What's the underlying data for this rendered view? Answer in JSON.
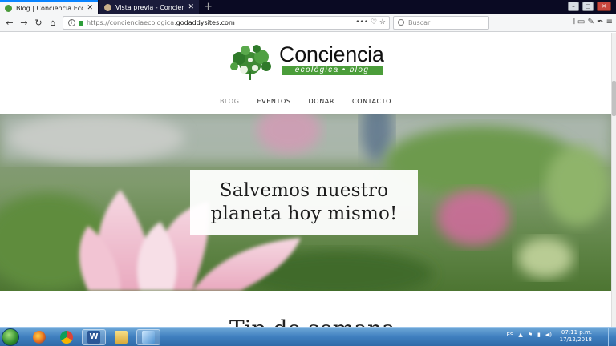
{
  "browser": {
    "tabs": [
      {
        "title": "Blog | Conciencia Ecológica",
        "close": "✕"
      },
      {
        "title": "Vista previa - Conciencia Ecoló",
        "close": "✕"
      }
    ],
    "new_tab": "+",
    "url_prefix": "https://concienciaecologica.",
    "url_domain": "godaddysites.com",
    "url_actions": "••• ♡ ☆",
    "search_placeholder": "Buscar",
    "tools": "𝄃 ▭ ✎ ✒ ≡"
  },
  "site": {
    "brand_name": "Conciencia",
    "brand_tagline": "ecológica • blog",
    "menu": [
      "BLOG",
      "EVENTOS",
      "DONAR",
      "CONTACTO"
    ],
    "hero_heading": "Salvemos nuestro planeta hoy mismo!",
    "partial_heading": "Tip de semana"
  },
  "taskbar": {
    "language": "ES",
    "time": "07:11 p.m.",
    "date": "17/12/2018"
  },
  "colors": {
    "brand_green": "#4b9d3a",
    "tab_accent": "#0a84ff"
  }
}
